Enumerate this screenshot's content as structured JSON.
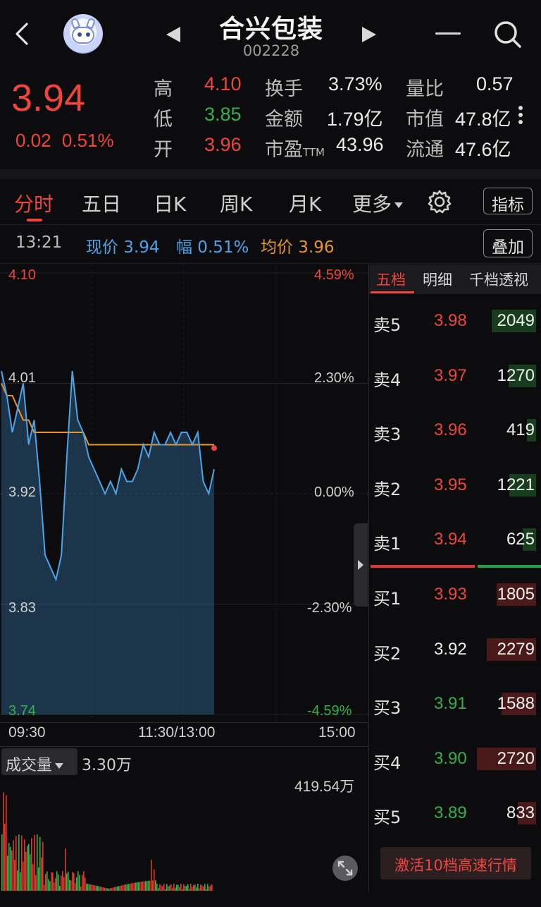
{
  "header": {
    "title": "合兴包装",
    "code": "002228"
  },
  "quote": {
    "price": "3.94",
    "change": "0.02",
    "change_pct": "0.51%",
    "stats": [
      {
        "label": "高",
        "value": "4.10"
      },
      {
        "label": "低",
        "value": "3.85"
      },
      {
        "label": "开",
        "value": "3.96"
      },
      {
        "label": "换手",
        "value": "3.73%"
      },
      {
        "label": "金额",
        "value": "1.79亿"
      },
      {
        "label": "市盈",
        "suffix": "TTM",
        "value": "43.96"
      },
      {
        "label": "量比",
        "value": "0.57"
      },
      {
        "label": "市值",
        "value": "47.8亿"
      },
      {
        "label": "流通",
        "value": "47.6亿"
      }
    ]
  },
  "tabs": [
    "分时",
    "五日",
    "日K",
    "周K",
    "月K",
    "更多"
  ],
  "tab_buttons": {
    "indicator": "指标",
    "overlay": "叠加"
  },
  "info_row": {
    "time": "13:21",
    "now_price": "现价 3.94",
    "amp": "幅 0.51%",
    "avg_price": "均价 3.96"
  },
  "chart_axes": {
    "price_labels": [
      "4.10",
      "4.01",
      "3.92",
      "3.83",
      "3.74"
    ],
    "pct_labels": [
      "4.59%",
      "2.30%",
      "0.00%",
      "-2.30%",
      "-4.59%"
    ],
    "time_labels": [
      "09:30",
      "11:30/13:00",
      "15:00"
    ]
  },
  "chart_data": {
    "type": "line",
    "ylim": [
      3.74,
      4.1
    ],
    "series": [
      {
        "values": [
          4.02,
          4.0,
          3.97,
          3.99,
          4.01,
          3.96,
          3.98,
          3.93,
          3.87,
          3.86,
          3.85,
          3.87,
          3.95,
          4.02,
          3.98,
          3.97,
          3.95,
          3.94,
          3.93,
          3.92,
          3.93,
          3.92,
          3.94,
          3.93,
          3.93,
          3.94,
          3.96,
          3.95,
          3.97,
          3.96,
          3.96,
          3.97,
          3.96,
          3.97,
          3.97,
          3.96,
          3.97,
          3.93,
          3.92,
          3.94
        ],
        "color": "#4da3e8"
      },
      {
        "values": [
          4.01,
          4.0,
          4.0,
          3.99,
          3.98,
          3.98,
          3.97,
          3.97,
          3.97,
          3.97,
          3.97,
          3.97,
          3.97,
          3.97,
          3.97,
          3.97,
          3.96,
          3.96,
          3.96,
          3.96,
          3.96,
          3.96,
          3.96,
          3.96,
          3.96,
          3.96,
          3.96,
          3.96,
          3.96,
          3.96,
          3.96,
          3.96,
          3.96,
          3.96,
          3.96,
          3.96,
          3.96,
          3.96,
          3.96,
          3.96
        ],
        "color": "#e8962c"
      }
    ]
  },
  "volume": {
    "selector": "成交量",
    "current": "3.30万",
    "max": "419.54万"
  },
  "book": {
    "tabs": [
      "五档",
      "明细",
      "千档透视"
    ],
    "asks": [
      {
        "label": "卖5",
        "price": "3.98",
        "qty": "2049",
        "color": "red"
      },
      {
        "label": "卖4",
        "price": "3.97",
        "qty": "1270",
        "color": "red"
      },
      {
        "label": "卖3",
        "price": "3.96",
        "qty": "419",
        "color": "red"
      },
      {
        "label": "卖2",
        "price": "3.95",
        "qty": "1221",
        "color": "red"
      },
      {
        "label": "卖1",
        "price": "3.94",
        "qty": "625",
        "color": "red"
      }
    ],
    "bids": [
      {
        "label": "买1",
        "price": "3.93",
        "qty": "1805",
        "color": "red"
      },
      {
        "label": "买2",
        "price": "3.92",
        "qty": "2279",
        "color": "white"
      },
      {
        "label": "买3",
        "price": "3.91",
        "qty": "1588",
        "color": "green"
      },
      {
        "label": "买4",
        "price": "3.90",
        "qty": "2720",
        "color": "green"
      },
      {
        "label": "买5",
        "price": "3.89",
        "qty": "833",
        "color": "green"
      }
    ],
    "activate": "激活10档高速行情"
  }
}
